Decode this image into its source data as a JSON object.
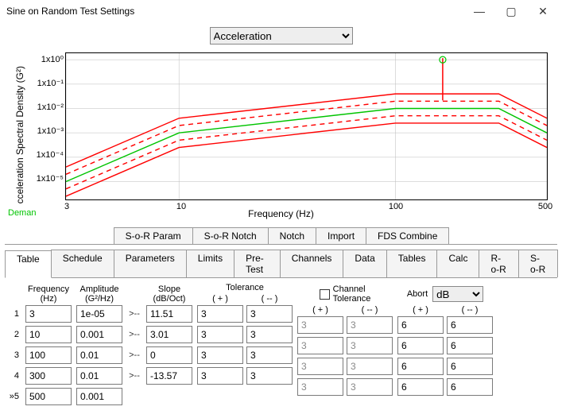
{
  "window": {
    "title": "Sine on Random Test Settings"
  },
  "top_dropdown": {
    "selected": "Acceleration"
  },
  "chart_data": {
    "type": "line",
    "xlabel": "Frequency (Hz)",
    "ylabel": "cceleration Spectral Density (G²)",
    "x_scale": "log",
    "y_scale": "log",
    "xlim": [
      3,
      500
    ],
    "ylim": [
      1e-06,
      2
    ],
    "xticks": [
      3,
      10,
      100,
      500
    ],
    "yticks_labels": [
      "1x10⁰",
      "1x10⁻¹",
      "1x10⁻²",
      "1x10⁻³",
      "1x10⁻⁴",
      "1x10⁻⁵"
    ],
    "yticks_values": [
      1,
      0.1,
      0.01,
      0.001,
      0.0001,
      1e-05
    ],
    "series": [
      {
        "name": "upper-abort",
        "color": "#ff0000",
        "style": "solid",
        "x": [
          3,
          10,
          100,
          300,
          500
        ],
        "y": [
          4e-05,
          0.004,
          0.04,
          0.04,
          0.004
        ]
      },
      {
        "name": "upper-tol",
        "color": "#ff0000",
        "style": "dashed",
        "x": [
          3,
          10,
          100,
          300,
          500
        ],
        "y": [
          2e-05,
          0.002,
          0.02,
          0.02,
          0.002
        ]
      },
      {
        "name": "demand",
        "color": "#00c400",
        "style": "solid",
        "x": [
          3,
          10,
          100,
          300,
          500
        ],
        "y": [
          1e-05,
          0.001,
          0.01,
          0.01,
          0.001
        ]
      },
      {
        "name": "lower-tol",
        "color": "#ff0000",
        "style": "dashed",
        "x": [
          3,
          10,
          100,
          300,
          500
        ],
        "y": [
          5e-06,
          0.0005,
          0.005,
          0.005,
          0.0005
        ]
      },
      {
        "name": "lower-abort",
        "color": "#ff0000",
        "style": "solid",
        "x": [
          3,
          10,
          100,
          300,
          500
        ],
        "y": [
          2.5e-06,
          0.00025,
          0.0025,
          0.0025,
          0.00025
        ]
      }
    ],
    "demand_label": "Deman",
    "marker": {
      "x": 165,
      "y": 1.0,
      "color": "#ff0000"
    }
  },
  "tabs_top": [
    "S-o-R Param",
    "S-o-R Notch",
    "Notch",
    "Import",
    "FDS Combine"
  ],
  "tabs_bottom": [
    "Table",
    "Schedule",
    "Parameters",
    "Limits",
    "Pre-Test",
    "Channels",
    "Data",
    "Tables",
    "Calc",
    "R-o-R",
    "S-o-R"
  ],
  "tabs_bottom_active": "Table",
  "table": {
    "headers": {
      "freq": "Frequency\n(Hz)",
      "amp": "Amplitude\n(G²/Hz)",
      "slope": "Slope\n(dB/Oct)",
      "tol": "Tolerance",
      "chtol": "Channel\nTolerance",
      "abort": "Abort",
      "plus": "( + )",
      "minus": "( -- )"
    },
    "abort_unit": "dB",
    "channel_tol_checked": false,
    "rows": [
      {
        "n": "1",
        "freq": "3",
        "amp": "1e-05",
        "slope": "11.51",
        "tol_p": "3",
        "tol_m": "3",
        "ct_p": "3",
        "ct_m": "3",
        "ab_p": "6",
        "ab_m": "6"
      },
      {
        "n": "2",
        "freq": "10",
        "amp": "0.001",
        "slope": "3.01",
        "tol_p": "3",
        "tol_m": "3",
        "ct_p": "3",
        "ct_m": "3",
        "ab_p": "6",
        "ab_m": "6"
      },
      {
        "n": "3",
        "freq": "100",
        "amp": "0.01",
        "slope": "0",
        "tol_p": "3",
        "tol_m": "3",
        "ct_p": "3",
        "ct_m": "3",
        "ab_p": "6",
        "ab_m": "6"
      },
      {
        "n": "4",
        "freq": "300",
        "amp": "0.01",
        "slope": "-13.57",
        "tol_p": "3",
        "tol_m": "3",
        "ct_p": "3",
        "ct_m": "3",
        "ab_p": "6",
        "ab_m": "6"
      },
      {
        "n": "5",
        "freq": "500",
        "amp": "0.001",
        "slope": "",
        "tol_p": "",
        "tol_m": "",
        "ct_p": "",
        "ct_m": "",
        "ab_p": "",
        "ab_m": ""
      }
    ],
    "cursor_row": 5
  }
}
